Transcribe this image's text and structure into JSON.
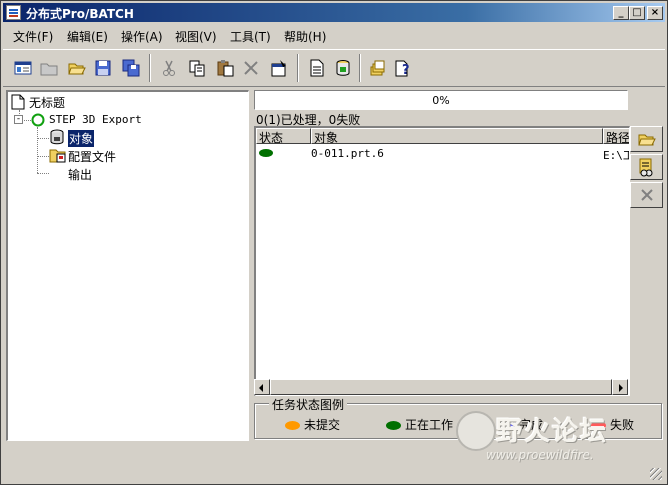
{
  "window": {
    "title": "分布式Pro/BATCH",
    "min": "_",
    "max": "□",
    "close": "×"
  },
  "menu": [
    "文件(F)",
    "编辑(E)",
    "操作(A)",
    "视图(V)",
    "工具(T)",
    "帮助(H)"
  ],
  "toolbar_icons": [
    "new-job-icon",
    "open-folder-icon",
    "open-icon",
    "save-icon",
    "save-all-icon",
    "cut-icon",
    "copy-icon",
    "paste-icon",
    "delete-icon",
    "properties-icon",
    "document-icon",
    "submit-icon",
    "stack-icon",
    "help-icon"
  ],
  "tree": {
    "root": "无标题",
    "task": "STEP 3D Export",
    "objects": "对象",
    "config": "配置文件",
    "output": "输出"
  },
  "progress": {
    "text": "0%",
    "value": 0
  },
  "summary": "0(1)已处理，0失败",
  "list": {
    "columns": [
      "状态",
      "对象",
      "路径"
    ],
    "rows": [
      {
        "status_color": "#007000",
        "object": "0-011.prt.6",
        "path": "E:\\工"
      }
    ]
  },
  "side_buttons": [
    "add-object-icon",
    "search-object-icon",
    "remove-object-icon"
  ],
  "legend": {
    "title": "任务状态图例",
    "items": [
      {
        "label": "未提交",
        "color": "#ff9900"
      },
      {
        "label": "正在工作",
        "color": "#007000"
      },
      {
        "label": "完成",
        "color": "#6a6aff"
      },
      {
        "label": "失败",
        "color": "#ff5a5a"
      }
    ]
  },
  "watermark": {
    "text": "野火论坛",
    "url": "www.proewildfire."
  }
}
